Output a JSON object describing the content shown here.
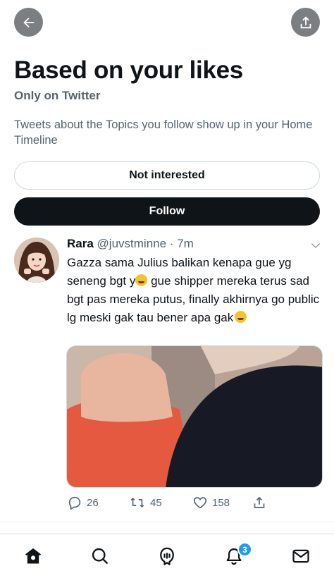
{
  "header": {
    "back_icon": "arrow-left-icon",
    "share_icon": "share-icon"
  },
  "topic": {
    "title": "Based on your likes",
    "subtitle": "Only on Twitter",
    "description": "Tweets about the Topics you follow show up in your Home Timeline",
    "not_interested_label": "Not interested",
    "follow_label": "Follow"
  },
  "tweet": {
    "name": "Rara",
    "handle": "@juvstminne",
    "separator": "·",
    "time": "7m",
    "text_part1": "Gazza sama Julius balikan kenapa gue yg seneng bgt y",
    "text_part2": " gue shipper mereka terus sad bgt pas mereka putus, finally akhirnya go public lg meski gak tau bener apa gak",
    "replies": "26",
    "retweets": "45",
    "likes": "158"
  },
  "bottom_nav": {
    "items": [
      "home-icon",
      "search-icon",
      "spaces-icon",
      "notifications-icon",
      "messages-icon"
    ],
    "notification_count": "3"
  },
  "colors": {
    "text": "#0f1419",
    "secondary": "#536471",
    "accent": "#1d9bf0",
    "follow_button": "#0f1419"
  }
}
